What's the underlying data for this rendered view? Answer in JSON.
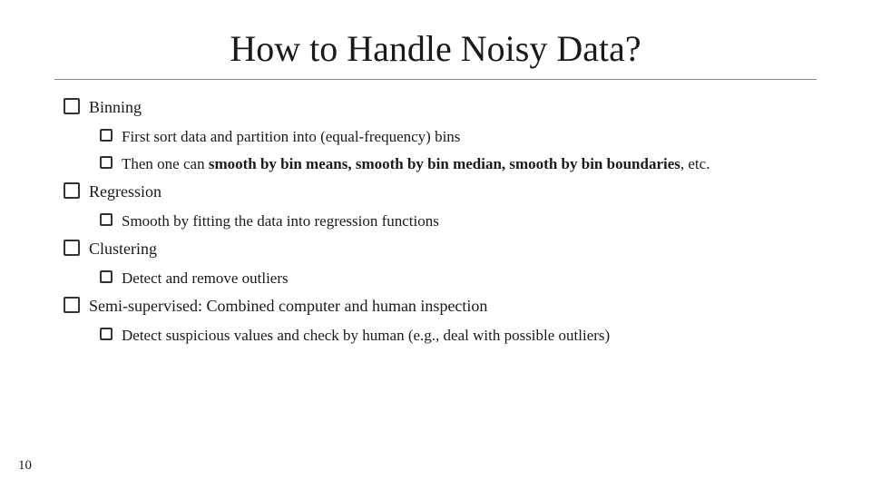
{
  "slide": {
    "title": "How to Handle Noisy Data?",
    "page_number": "10",
    "items": [
      {
        "level": 1,
        "text": "Binning",
        "children": [
          {
            "level": 2,
            "text": "First sort data and partition into (equal-frequency) bins"
          },
          {
            "level": 2,
            "text_parts": [
              {
                "text": "Then one can ",
                "bold": false
              },
              {
                "text": "smooth by bin means, smooth by bin median, smooth by bin boundaries",
                "bold": true
              },
              {
                "text": ", etc.",
                "bold": false
              }
            ]
          }
        ]
      },
      {
        "level": 1,
        "text": "Regression",
        "children": [
          {
            "level": 2,
            "text": "Smooth by fitting the data into regression functions"
          }
        ]
      },
      {
        "level": 1,
        "text": "Clustering",
        "children": [
          {
            "level": 2,
            "text": "Detect and remove outliers"
          }
        ]
      },
      {
        "level": 1,
        "text": "Semi-supervised: Combined computer and human inspection",
        "children": [
          {
            "level": 2,
            "text": "Detect suspicious values and check by human (e.g., deal with possible outliers)"
          }
        ]
      }
    ]
  }
}
